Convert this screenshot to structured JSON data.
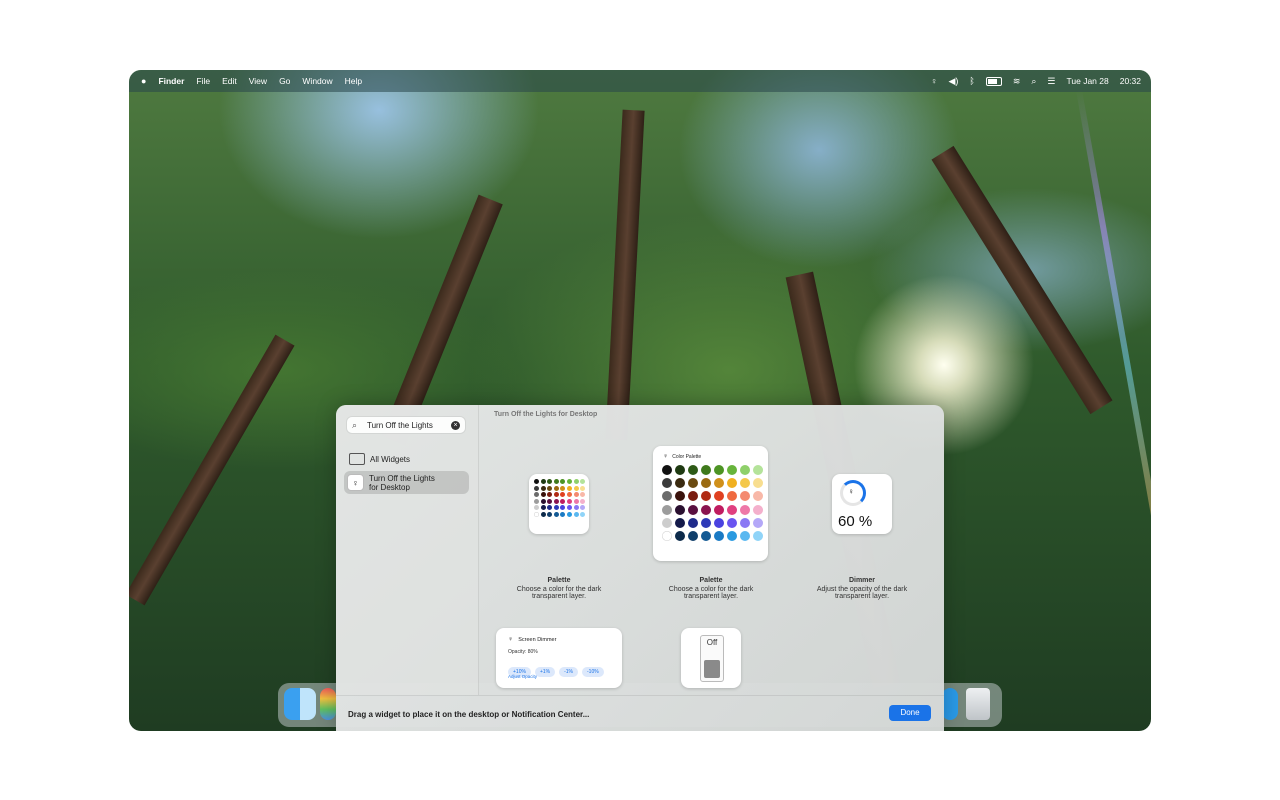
{
  "menubar": {
    "app": "Finder",
    "items": [
      "File",
      "Edit",
      "View",
      "Go",
      "Window",
      "Help"
    ],
    "datetime_date": "Tue Jan 28",
    "datetime_time": "20:32",
    "icons": [
      "apple-icon",
      "lightbulb-icon",
      "volume-icon",
      "bluetooth-icon",
      "battery-icon",
      "wifi-icon",
      "spotlight-icon",
      "control-center-icon"
    ]
  },
  "gallery": {
    "search_value": "Turn Off the Lights",
    "sidebar": {
      "all_widgets": "All Widgets",
      "app_line1": "Turn Off the Lights",
      "app_line2": "for Desktop"
    },
    "content_title": "Turn Off the Lights for Desktop",
    "widgets": {
      "palette_small": {
        "title": "Palette",
        "desc1": "Choose a color for the dark",
        "desc2": "transparent layer."
      },
      "palette_medium": {
        "header": "Color Palette",
        "title": "Palette",
        "desc1": "Choose a color for the dark",
        "desc2": "transparent layer."
      },
      "dimmer": {
        "value": "60 %",
        "title": "Dimmer",
        "desc1": "Adjust the opacity of the dark",
        "desc2": "transparent layer."
      },
      "screen_dimmer": {
        "header": "Screen Dimmer",
        "opacity": "Opacity: 80%",
        "buttons": [
          "+10%",
          "+1%",
          "-1%",
          "-10%"
        ],
        "link": "Adjust Opacity"
      },
      "toggle": {
        "state": "Off"
      }
    },
    "footer_hint": "Drag a widget to place it on the desktop or Notification Center...",
    "done": "Done"
  },
  "colors": {
    "accent": "#1a73e8",
    "palette": [
      [
        "#111111",
        "#1f3a12",
        "#2e5a16",
        "#3f7a1c",
        "#4d9424",
        "#67b43b",
        "#8fd06a",
        "#b4e39a"
      ],
      [
        "#3b3b3b",
        "#3a2a10",
        "#6a4a10",
        "#9a6a10",
        "#d0901a",
        "#f0b020",
        "#f4c84a",
        "#f8de90"
      ],
      [
        "#6b6b6b",
        "#3a120c",
        "#7a1c10",
        "#b02a14",
        "#e04020",
        "#ef6a40",
        "#f48a70",
        "#f8b8a8"
      ],
      [
        "#9c9c9c",
        "#2a1030",
        "#5a1040",
        "#8a1450",
        "#c01c60",
        "#e04080",
        "#ee78a8",
        "#f4b0cc"
      ],
      [
        "#cdcdcd",
        "#141a4a",
        "#1e2a8a",
        "#2e3ab8",
        "#4a42e0",
        "#6a54f0",
        "#8a78f4",
        "#b4a8f8"
      ],
      [
        "#ffffff",
        "#0c2a4a",
        "#103e6a",
        "#145a94",
        "#1a7ac4",
        "#2a9ae0",
        "#5ab8f0",
        "#90d4f8"
      ]
    ]
  }
}
